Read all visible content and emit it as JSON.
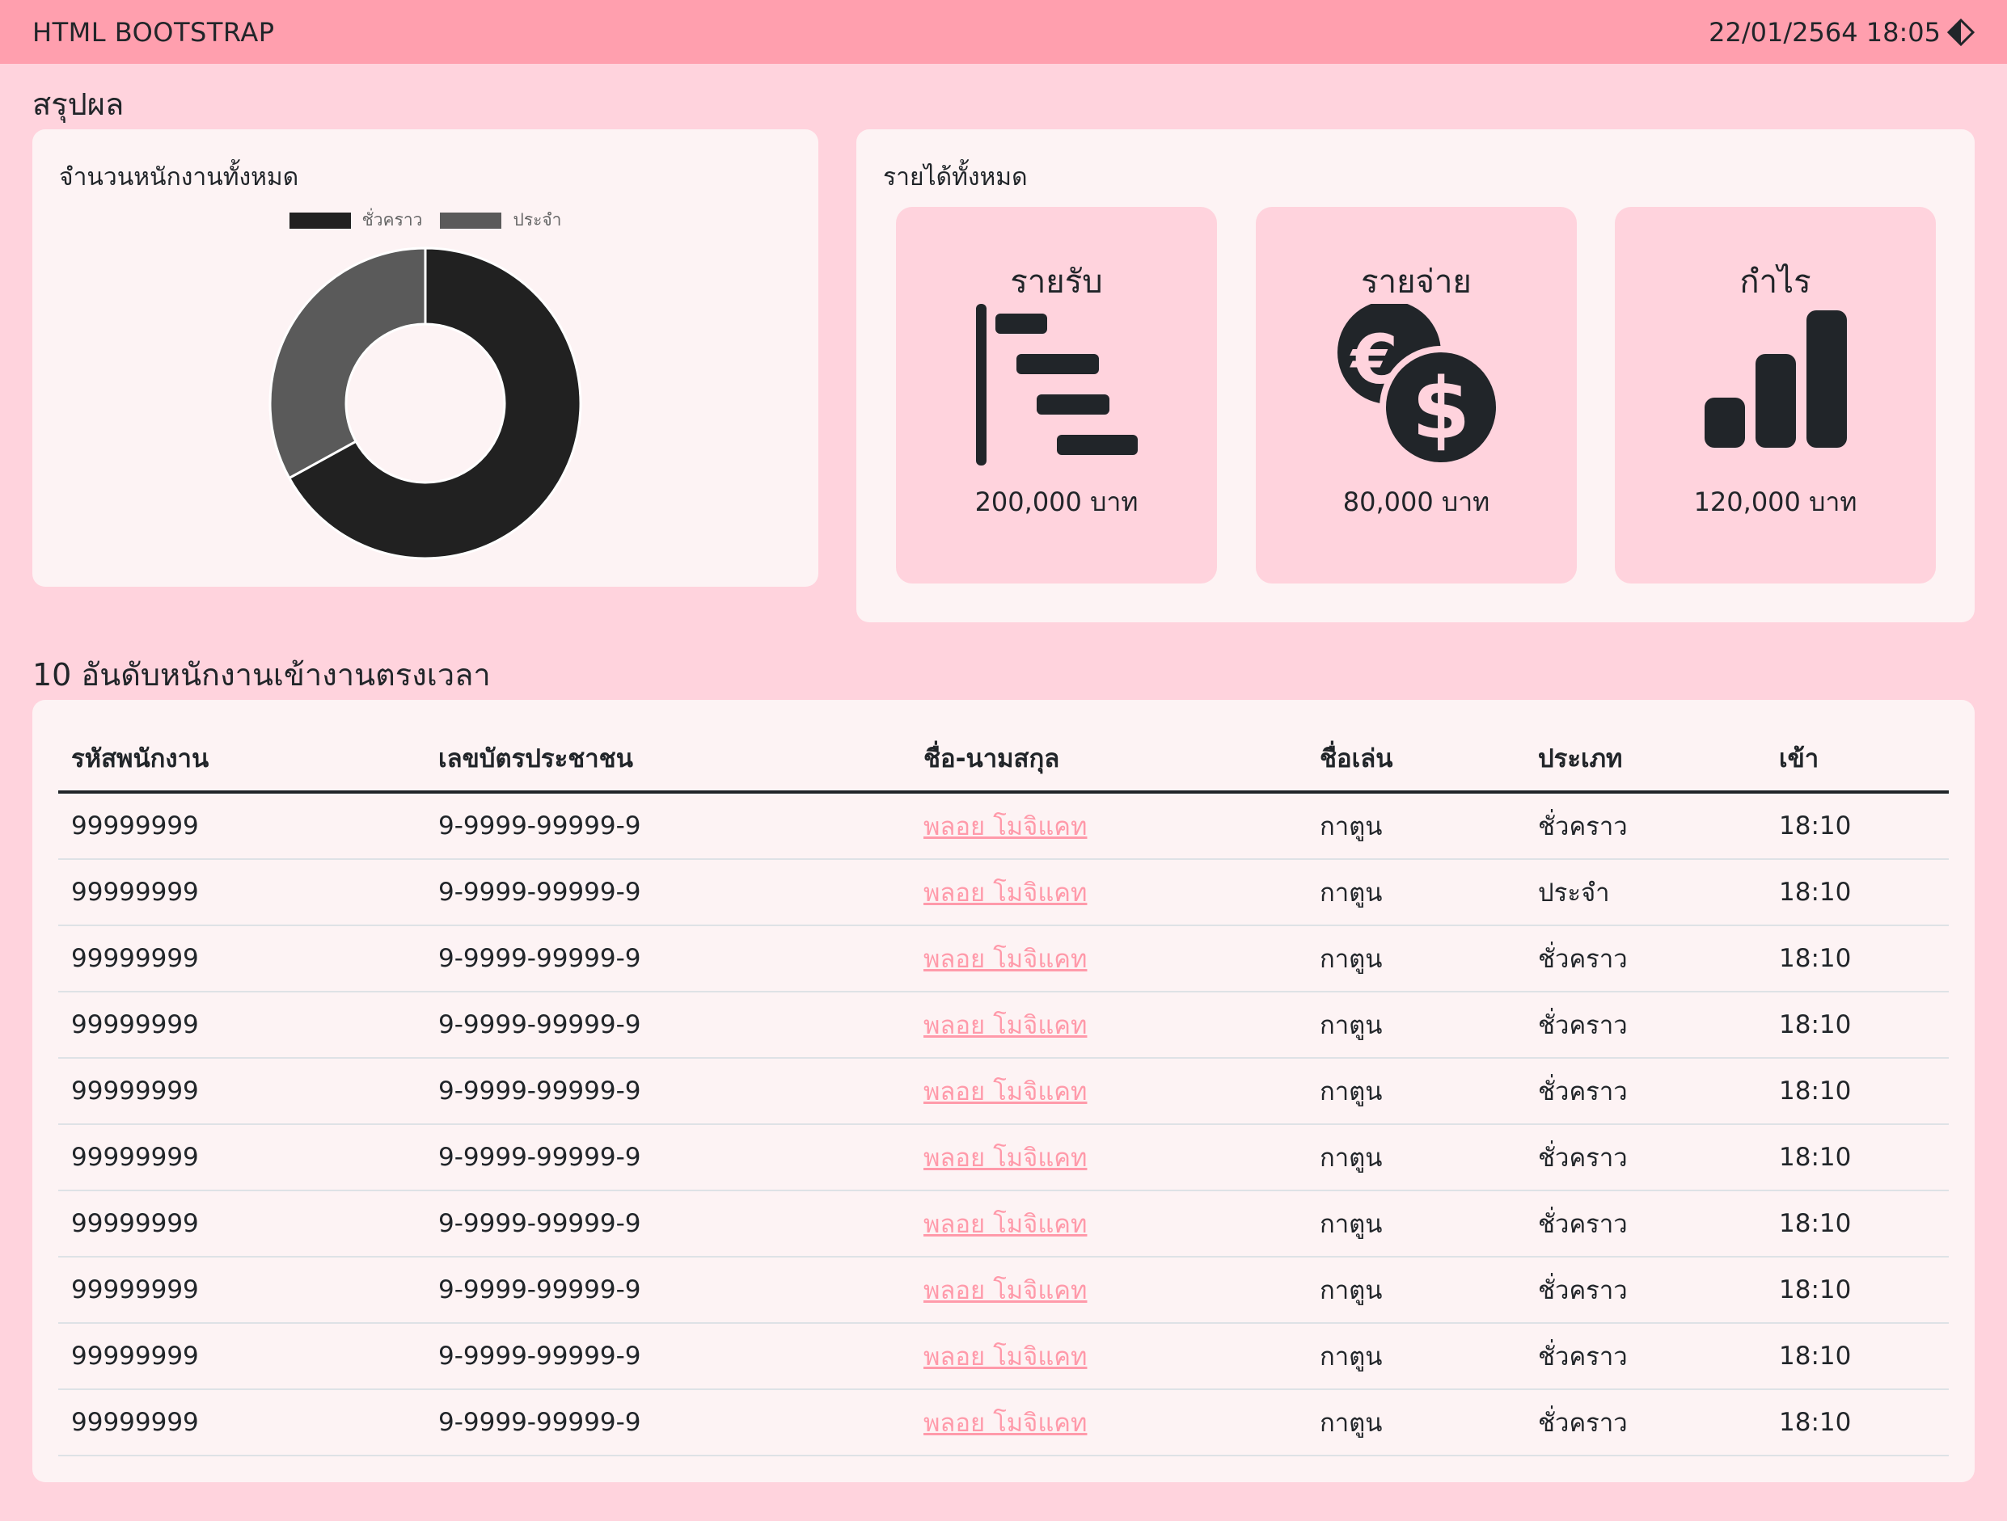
{
  "navbar": {
    "brand": "HTML BOOTSTRAP",
    "datetime": "22/01/2564 18:05"
  },
  "summary": {
    "title": "สรุปผล",
    "employees_card": {
      "title": "จำนวนหนักงานทั้งหมด"
    },
    "income_card": {
      "title": "รายได้ทั้งหมด",
      "stats": [
        {
          "label": "รายรับ",
          "value": "200,000 บาท",
          "icon": "bar-chart-steps-icon"
        },
        {
          "label": "รายจ่าย",
          "value": "80,000 บาท",
          "icon": "coin-currency-icon"
        },
        {
          "label": "กำไร",
          "value": "120,000 บาท",
          "icon": "signal-bars-icon"
        }
      ]
    }
  },
  "chart_data": {
    "type": "pie",
    "categories": [
      "ชั่วคราว",
      "ประจำ"
    ],
    "values": [
      67,
      33
    ],
    "colors": [
      "#212121",
      "#5a5a5a"
    ],
    "legend": "top"
  },
  "table_section": {
    "title": "10 อันดับหนักงานเข้างานตรงเวลา",
    "headers": [
      "รหัสพนักงาน",
      "เลขบัตรประชาชน",
      "ชื่อ-นามสกุล",
      "ชื่อเล่น",
      "ประเภท",
      "เข้า"
    ],
    "rows": [
      [
        "99999999",
        "9-9999-99999-9",
        "พลอย โมจิแคท",
        "กาตูน",
        "ชั่วคราว",
        "18:10"
      ],
      [
        "99999999",
        "9-9999-99999-9",
        "พลอย โมจิแคท",
        "กาตูน",
        "ประจำ",
        "18:10"
      ],
      [
        "99999999",
        "9-9999-99999-9",
        "พลอย โมจิแคท",
        "กาตูน",
        "ชั่วคราว",
        "18:10"
      ],
      [
        "99999999",
        "9-9999-99999-9",
        "พลอย โมจิแคท",
        "กาตูน",
        "ชั่วคราว",
        "18:10"
      ],
      [
        "99999999",
        "9-9999-99999-9",
        "พลอย โมจิแคท",
        "กาตูน",
        "ชั่วคราว",
        "18:10"
      ],
      [
        "99999999",
        "9-9999-99999-9",
        "พลอย โมจิแคท",
        "กาตูน",
        "ชั่วคราว",
        "18:10"
      ],
      [
        "99999999",
        "9-9999-99999-9",
        "พลอย โมจิแคท",
        "กาตูน",
        "ชั่วคราว",
        "18:10"
      ],
      [
        "99999999",
        "9-9999-99999-9",
        "พลอย โมจิแคท",
        "กาตูน",
        "ชั่วคราว",
        "18:10"
      ],
      [
        "99999999",
        "9-9999-99999-9",
        "พลอย โมจิแคท",
        "กาตูน",
        "ชั่วคราว",
        "18:10"
      ],
      [
        "99999999",
        "9-9999-99999-9",
        "พลอย โมจิแคท",
        "กาตูน",
        "ชั่วคราว",
        "18:10"
      ]
    ]
  },
  "colors": {
    "navbar": "#ff9fae",
    "page_background": "#ffd3dd",
    "card_background": "#fdf3f4",
    "link": "#ff9aaa"
  }
}
